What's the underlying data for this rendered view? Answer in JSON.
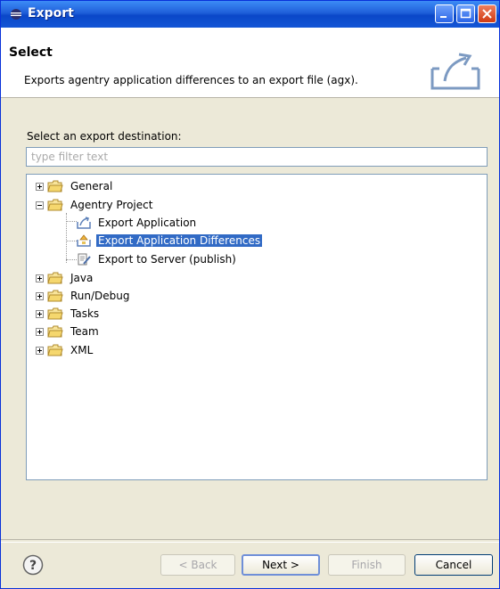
{
  "window": {
    "title": "Export"
  },
  "header": {
    "title": "Select",
    "description": "Exports agentry application differences to an export file (agx)."
  },
  "destination": {
    "label": "Select an export destination:",
    "filter_placeholder": "type filter text"
  },
  "tree": {
    "general": "General",
    "agentry_project": "Agentry Project",
    "export_application": "Export Application",
    "export_application_differences": "Export Application Differences",
    "export_to_server": "Export to Server (publish)",
    "java": "Java",
    "run_debug": "Run/Debug",
    "tasks": "Tasks",
    "team": "Team",
    "xml": "XML",
    "selected": "Export Application Differences"
  },
  "buttons": {
    "back": "< Back",
    "next": "Next >",
    "finish": "Finish",
    "cancel": "Cancel"
  },
  "colors": {
    "selection": "#316ac5",
    "titlebar": "#0a47c8",
    "folder": "#f5d76e"
  }
}
